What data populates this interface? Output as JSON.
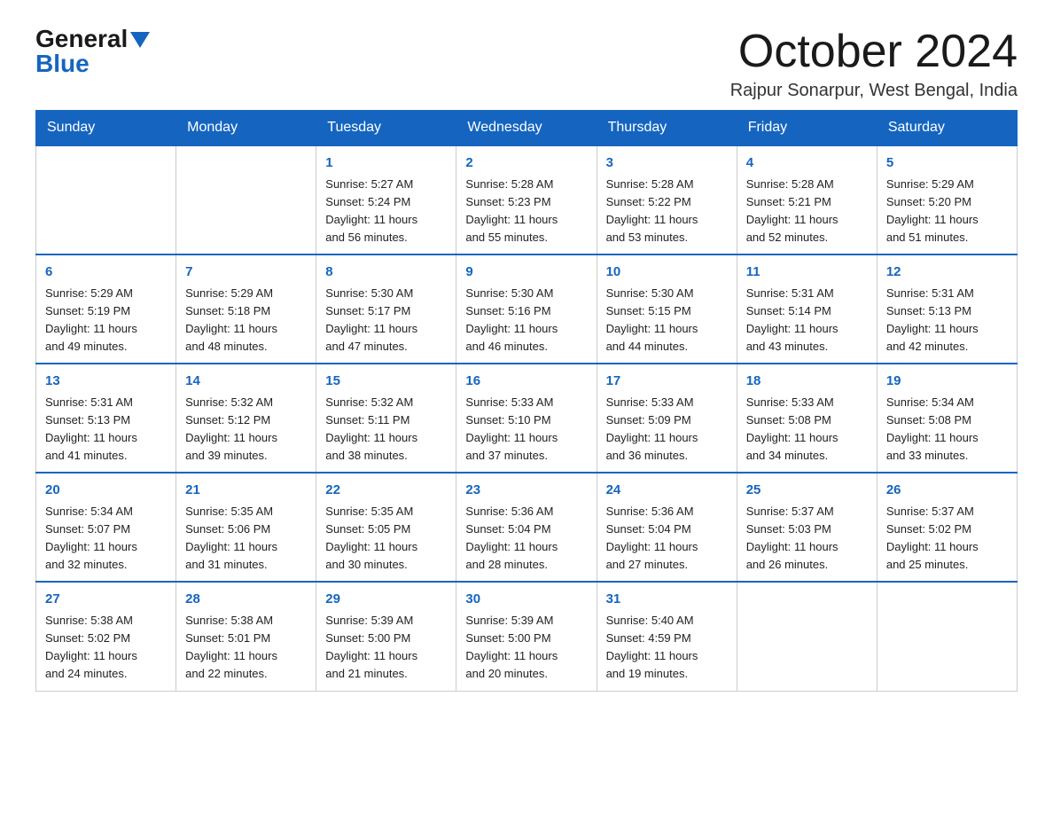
{
  "header": {
    "logo": {
      "general": "General",
      "blue": "Blue",
      "arrow": "▲"
    },
    "title": "October 2024",
    "subtitle": "Rajpur Sonarpur, West Bengal, India"
  },
  "calendar": {
    "days": [
      "Sunday",
      "Monday",
      "Tuesday",
      "Wednesday",
      "Thursday",
      "Friday",
      "Saturday"
    ],
    "weeks": [
      [
        {
          "day": "",
          "info": ""
        },
        {
          "day": "",
          "info": ""
        },
        {
          "day": "1",
          "info": "Sunrise: 5:27 AM\nSunset: 5:24 PM\nDaylight: 11 hours\nand 56 minutes."
        },
        {
          "day": "2",
          "info": "Sunrise: 5:28 AM\nSunset: 5:23 PM\nDaylight: 11 hours\nand 55 minutes."
        },
        {
          "day": "3",
          "info": "Sunrise: 5:28 AM\nSunset: 5:22 PM\nDaylight: 11 hours\nand 53 minutes."
        },
        {
          "day": "4",
          "info": "Sunrise: 5:28 AM\nSunset: 5:21 PM\nDaylight: 11 hours\nand 52 minutes."
        },
        {
          "day": "5",
          "info": "Sunrise: 5:29 AM\nSunset: 5:20 PM\nDaylight: 11 hours\nand 51 minutes."
        }
      ],
      [
        {
          "day": "6",
          "info": "Sunrise: 5:29 AM\nSunset: 5:19 PM\nDaylight: 11 hours\nand 49 minutes."
        },
        {
          "day": "7",
          "info": "Sunrise: 5:29 AM\nSunset: 5:18 PM\nDaylight: 11 hours\nand 48 minutes."
        },
        {
          "day": "8",
          "info": "Sunrise: 5:30 AM\nSunset: 5:17 PM\nDaylight: 11 hours\nand 47 minutes."
        },
        {
          "day": "9",
          "info": "Sunrise: 5:30 AM\nSunset: 5:16 PM\nDaylight: 11 hours\nand 46 minutes."
        },
        {
          "day": "10",
          "info": "Sunrise: 5:30 AM\nSunset: 5:15 PM\nDaylight: 11 hours\nand 44 minutes."
        },
        {
          "day": "11",
          "info": "Sunrise: 5:31 AM\nSunset: 5:14 PM\nDaylight: 11 hours\nand 43 minutes."
        },
        {
          "day": "12",
          "info": "Sunrise: 5:31 AM\nSunset: 5:13 PM\nDaylight: 11 hours\nand 42 minutes."
        }
      ],
      [
        {
          "day": "13",
          "info": "Sunrise: 5:31 AM\nSunset: 5:13 PM\nDaylight: 11 hours\nand 41 minutes."
        },
        {
          "day": "14",
          "info": "Sunrise: 5:32 AM\nSunset: 5:12 PM\nDaylight: 11 hours\nand 39 minutes."
        },
        {
          "day": "15",
          "info": "Sunrise: 5:32 AM\nSunset: 5:11 PM\nDaylight: 11 hours\nand 38 minutes."
        },
        {
          "day": "16",
          "info": "Sunrise: 5:33 AM\nSunset: 5:10 PM\nDaylight: 11 hours\nand 37 minutes."
        },
        {
          "day": "17",
          "info": "Sunrise: 5:33 AM\nSunset: 5:09 PM\nDaylight: 11 hours\nand 36 minutes."
        },
        {
          "day": "18",
          "info": "Sunrise: 5:33 AM\nSunset: 5:08 PM\nDaylight: 11 hours\nand 34 minutes."
        },
        {
          "day": "19",
          "info": "Sunrise: 5:34 AM\nSunset: 5:08 PM\nDaylight: 11 hours\nand 33 minutes."
        }
      ],
      [
        {
          "day": "20",
          "info": "Sunrise: 5:34 AM\nSunset: 5:07 PM\nDaylight: 11 hours\nand 32 minutes."
        },
        {
          "day": "21",
          "info": "Sunrise: 5:35 AM\nSunset: 5:06 PM\nDaylight: 11 hours\nand 31 minutes."
        },
        {
          "day": "22",
          "info": "Sunrise: 5:35 AM\nSunset: 5:05 PM\nDaylight: 11 hours\nand 30 minutes."
        },
        {
          "day": "23",
          "info": "Sunrise: 5:36 AM\nSunset: 5:04 PM\nDaylight: 11 hours\nand 28 minutes."
        },
        {
          "day": "24",
          "info": "Sunrise: 5:36 AM\nSunset: 5:04 PM\nDaylight: 11 hours\nand 27 minutes."
        },
        {
          "day": "25",
          "info": "Sunrise: 5:37 AM\nSunset: 5:03 PM\nDaylight: 11 hours\nand 26 minutes."
        },
        {
          "day": "26",
          "info": "Sunrise: 5:37 AM\nSunset: 5:02 PM\nDaylight: 11 hours\nand 25 minutes."
        }
      ],
      [
        {
          "day": "27",
          "info": "Sunrise: 5:38 AM\nSunset: 5:02 PM\nDaylight: 11 hours\nand 24 minutes."
        },
        {
          "day": "28",
          "info": "Sunrise: 5:38 AM\nSunset: 5:01 PM\nDaylight: 11 hours\nand 22 minutes."
        },
        {
          "day": "29",
          "info": "Sunrise: 5:39 AM\nSunset: 5:00 PM\nDaylight: 11 hours\nand 21 minutes."
        },
        {
          "day": "30",
          "info": "Sunrise: 5:39 AM\nSunset: 5:00 PM\nDaylight: 11 hours\nand 20 minutes."
        },
        {
          "day": "31",
          "info": "Sunrise: 5:40 AM\nSunset: 4:59 PM\nDaylight: 11 hours\nand 19 minutes."
        },
        {
          "day": "",
          "info": ""
        },
        {
          "day": "",
          "info": ""
        }
      ]
    ]
  }
}
